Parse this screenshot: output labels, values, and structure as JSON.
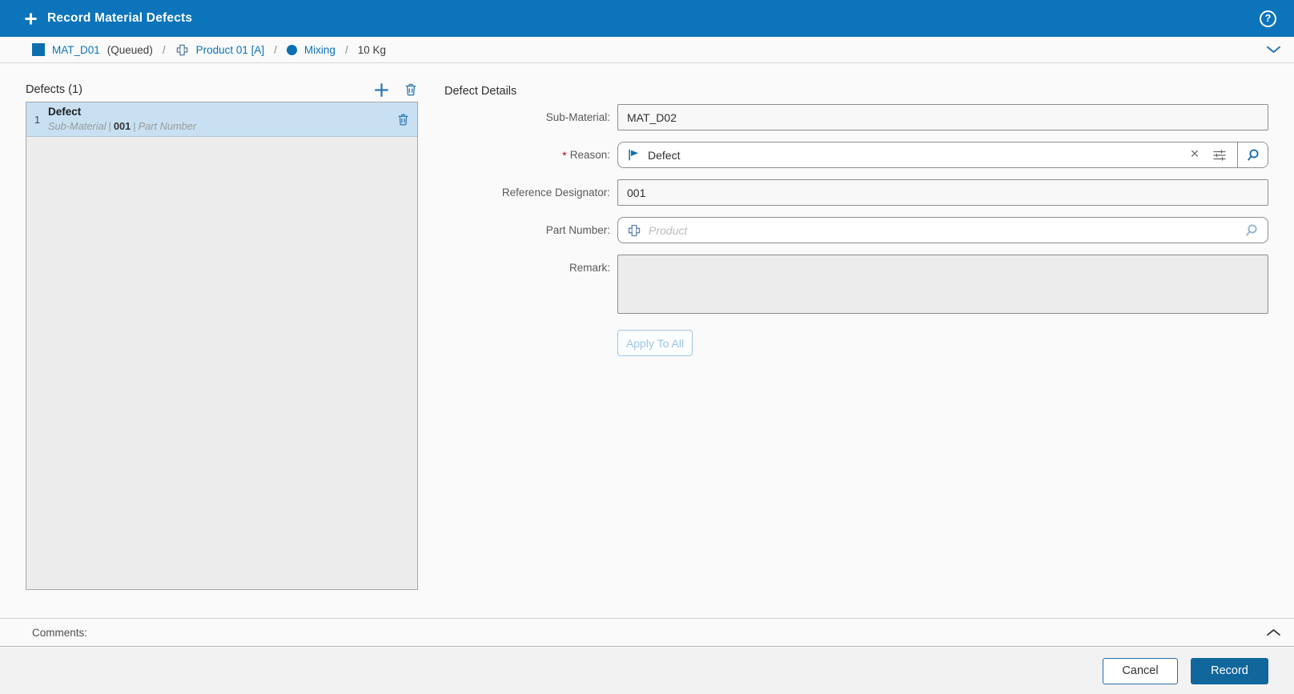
{
  "header": {
    "title": "Record Material Defects"
  },
  "breadcrumb": {
    "material": "MAT_D01",
    "status": "(Queued)",
    "separator": "/",
    "product": "Product 01 [A]",
    "operation": "Mixing",
    "quantity": "10 Kg"
  },
  "defects_panel": {
    "title": "Defects (1)",
    "items": [
      {
        "index": "1",
        "title": "Defect",
        "sub_material_label": "Sub-Material",
        "reference": "001",
        "part_number_label": "Part Number",
        "separator": "|"
      }
    ]
  },
  "details_panel": {
    "title": "Defect Details",
    "fields": {
      "sub_material": {
        "label": "Sub-Material:",
        "value": "MAT_D02"
      },
      "reason": {
        "label": "Reason:",
        "required_mark": "*",
        "value": "Defect"
      },
      "reference_designator": {
        "label": "Reference Designator:",
        "value": "001"
      },
      "part_number": {
        "label": "Part Number:",
        "placeholder": "Product"
      },
      "remark": {
        "label": "Remark:",
        "value": ""
      }
    },
    "apply_button": "Apply To All"
  },
  "comments": {
    "label": "Comments:"
  },
  "footer": {
    "cancel": "Cancel",
    "record": "Record"
  },
  "icons": {
    "plus": "+",
    "help": "?",
    "material": "square",
    "product": "part-cross",
    "operation": "circle",
    "chevron_down": "v",
    "chevron_up": "^",
    "add": "+",
    "delete": "trash",
    "flag": "flag",
    "clear": "✕",
    "filter": "sliders",
    "search": "magnifier"
  },
  "colors": {
    "header_bg": "#0b74ba",
    "link_blue": "#0d73b8",
    "icon_blue": "#2d77b2",
    "record_button_bg": "#11679c",
    "selected_item_bg": "#c8e0f2",
    "list_bg": "#ececec",
    "page_bg": "#fafafa",
    "footer_bg": "#f2f2f2"
  }
}
